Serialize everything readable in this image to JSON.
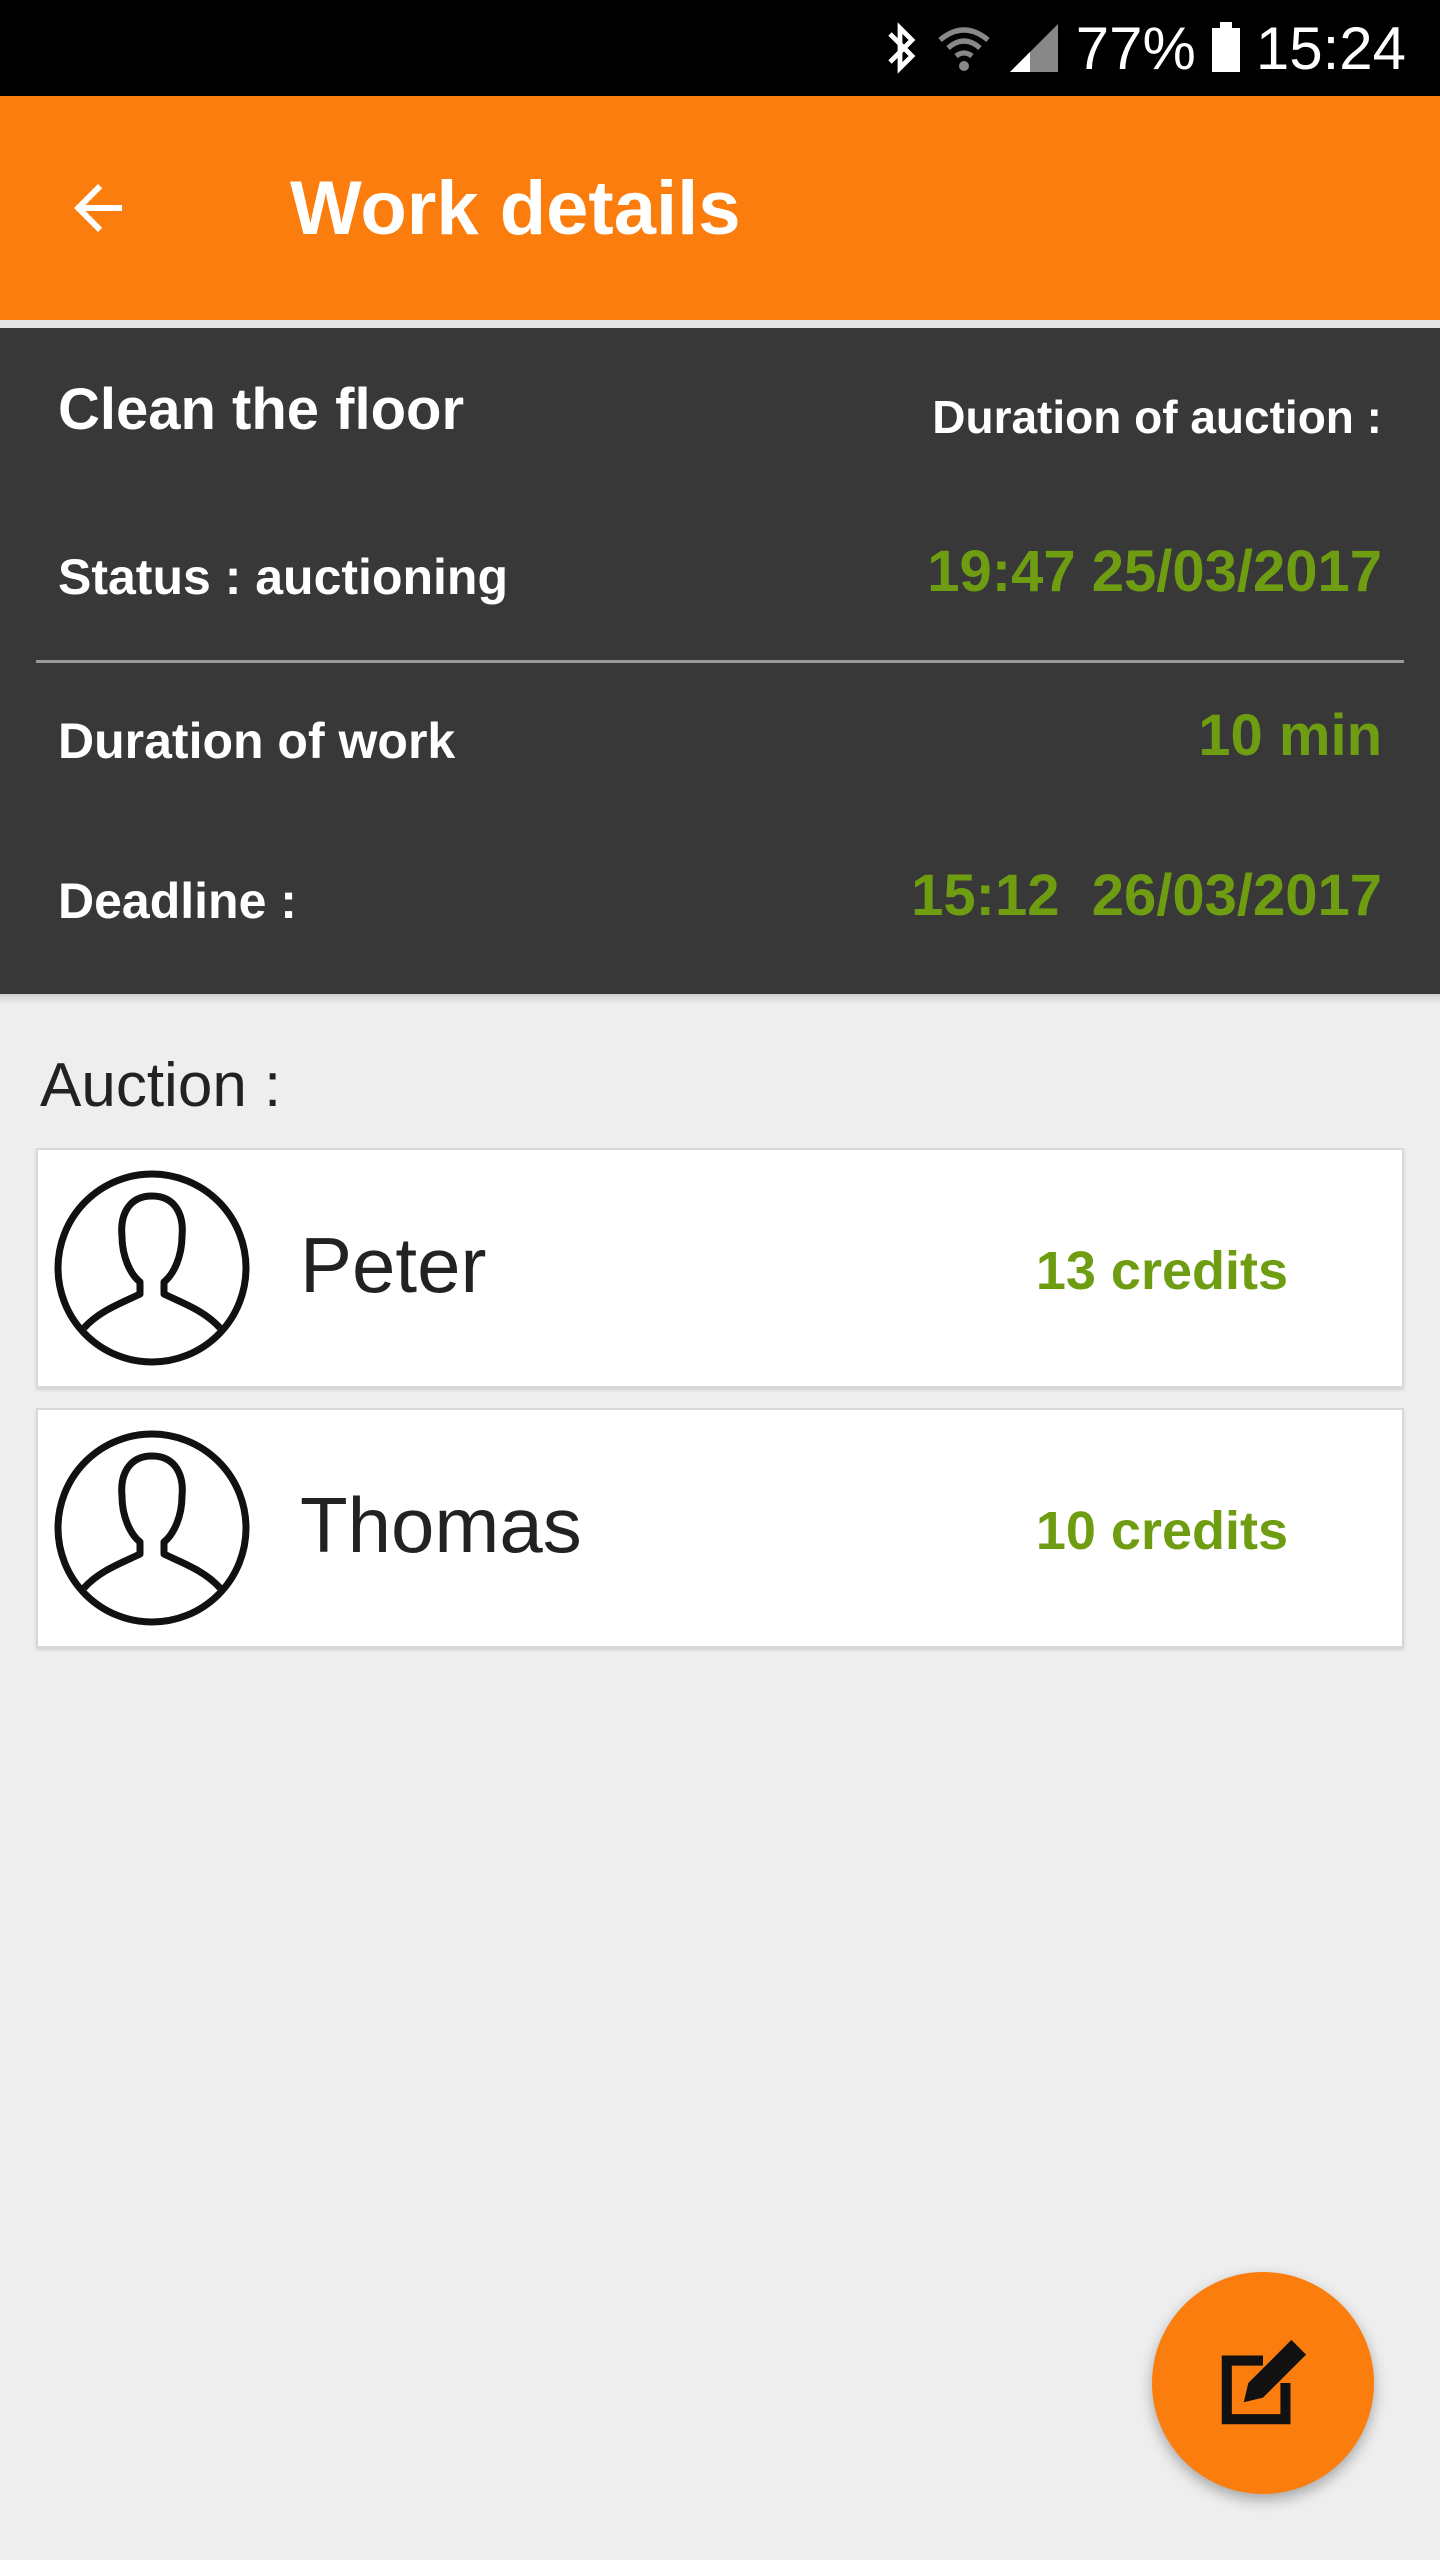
{
  "status_bar": {
    "battery": "77%",
    "time": "15:24",
    "icons": [
      "bluetooth-icon",
      "wifi-icon",
      "signal-icon",
      "battery-icon"
    ]
  },
  "app_bar": {
    "title": "Work details",
    "back_icon": "arrow-back-icon",
    "color": "#fa7d0d"
  },
  "details": {
    "task_name": "Clean the floor",
    "duration_of_auction_label": "Duration of auction :",
    "status_label": "Status : auctioning",
    "auction_end": "19:47 25/03/2017",
    "duration_of_work_label": "Duration of work",
    "duration_of_work_value": "10 min",
    "deadline_label": "Deadline :",
    "deadline_value": "15:12  26/03/2017",
    "value_color": "#6f9d12"
  },
  "auction": {
    "label": "Auction :",
    "bids": [
      {
        "name": "Peter",
        "credits": "13 credits",
        "avatar_icon": "person-avatar-icon"
      },
      {
        "name": "Thomas",
        "credits": "10 credits",
        "avatar_icon": "person-avatar-icon"
      }
    ]
  },
  "fab": {
    "icon": "edit-icon"
  }
}
